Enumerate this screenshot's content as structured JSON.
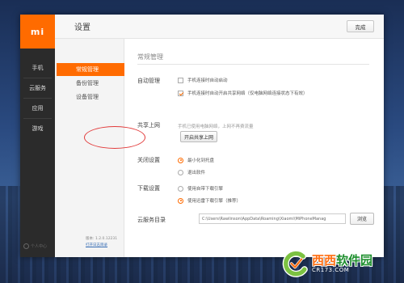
{
  "window": {
    "title": "设置",
    "done_label": "完成"
  },
  "logo": {
    "text": "mi",
    "color": "#ff6b00"
  },
  "leftbar": {
    "items": [
      {
        "label": "手机"
      },
      {
        "label": "云服务"
      },
      {
        "label": "应用"
      },
      {
        "label": "游戏"
      }
    ],
    "bottom_text": "个人中心"
  },
  "subnav": {
    "items": [
      {
        "label": "常规管理",
        "active": true
      },
      {
        "label": "备份管理",
        "active": false
      },
      {
        "label": "设备管理",
        "active": false
      }
    ],
    "version": "版本: 1.2.0.12231",
    "log_link": "打开日志目录"
  },
  "content": {
    "section_title": "常规管理",
    "auto_manage": {
      "label": "自动管理",
      "options": [
        {
          "text": "手机连接时自动启动",
          "checked": false
        },
        {
          "text": "手机连接时自动开启共享网络（仅电脑网络连接状态下有效）",
          "checked": true
        }
      ]
    },
    "share": {
      "label": "共享上网",
      "hint": "手机已使用电脑网络，上网不再费流量",
      "button_label": "开启共享上网"
    },
    "close_setting": {
      "label": "关闭设置",
      "options": [
        {
          "text": "最小化到托盘",
          "checked": true
        },
        {
          "text": "退出软件",
          "checked": false
        }
      ]
    },
    "download_setting": {
      "label": "下载设置",
      "options": [
        {
          "text": "使用自带下载引擎",
          "checked": false
        },
        {
          "text": "使用迅雷下载引擎（推荐）",
          "checked": true
        }
      ]
    },
    "cloud_dir": {
      "label": "云服务目录",
      "path": "C:\\Users\\Rawlinson\\AppData\\Roaming\\Xiaomi\\MiPhoneManag",
      "browse_label": "浏览"
    }
  },
  "watermark": {
    "brand_part1": "西西",
    "brand_part2": "软件园",
    "site": "CR173.COM"
  },
  "colors": {
    "accent": "#ff6b00",
    "annotation_red": "#e23b3b"
  }
}
